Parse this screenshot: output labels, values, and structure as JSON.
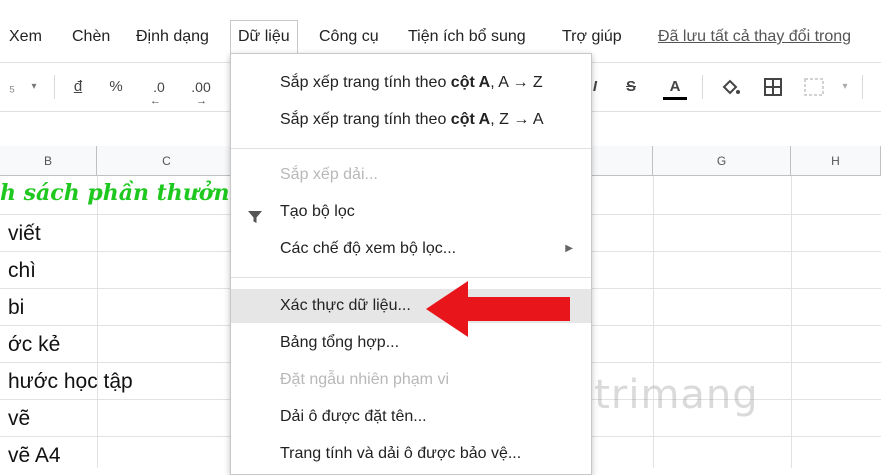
{
  "menubar": {
    "items": [
      "Xem",
      "Chèn",
      "Định dạng",
      "Dữ liệu",
      "Công cụ",
      "Tiện ích bổ sung",
      "Trợ giúp"
    ],
    "saved_status": "Đã lưu tất cả thay đổi trong"
  },
  "toolbar": {
    "currency": "đ",
    "percent": "%",
    "dec_less": ".0",
    "dec_more": ".00",
    "text_color_letter": "A"
  },
  "columns": [
    "B",
    "C",
    "G",
    "H"
  ],
  "cells": {
    "title": "h sách phần thưởng cu",
    "rows": [
      "viết",
      "chì",
      "bi",
      "ớc kẻ",
      "hước học tập",
      " vẽ",
      " vẽ A4"
    ]
  },
  "dropdown": {
    "sort_a_z_pre": "Sắp xếp trang tính theo ",
    "sort_a_z_bold": "cột A",
    "sort_a_z_post": ", A → Z",
    "sort_z_a_pre": "Sắp xếp trang tính theo ",
    "sort_z_a_bold": "cột A",
    "sort_z_a_post": ", Z → A",
    "sort_range": "Sắp xếp dải...",
    "create_filter": "Tạo bộ lọc",
    "filter_views": "Các chế độ xem bộ lọc...",
    "data_validation": "Xác thực dữ liệu...",
    "pivot_table": "Bảng tổng hợp...",
    "randomize": "Đặt ngẫu nhiên phạm vi",
    "named_ranges": "Dải ô được đặt tên...",
    "protected_sheets": "Trang tính và dải ô được bảo vệ..."
  },
  "watermark": "uantrimang",
  "colors": {
    "arrow": "#e8151b",
    "title_text": "#1fc81f"
  }
}
